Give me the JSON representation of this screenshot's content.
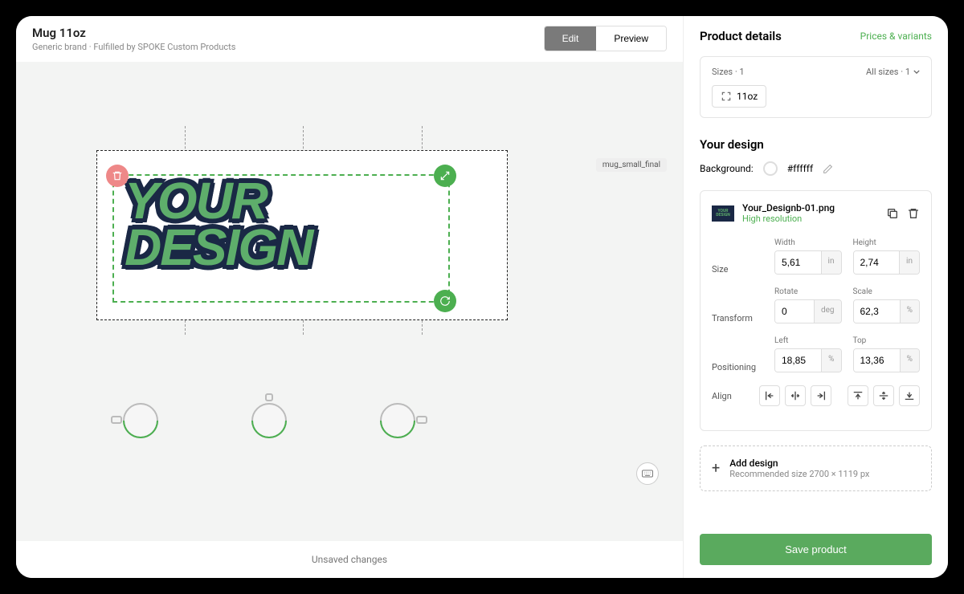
{
  "header": {
    "title": "Mug 11oz",
    "subtitle": "Generic brand · Fulfilled by SPOKE Custom Products",
    "tabs": {
      "edit": "Edit",
      "preview": "Preview"
    }
  },
  "canvas": {
    "design_tag": "mug_small_final",
    "design_text_line1": "YOUR",
    "design_text_line2": "DESIGN"
  },
  "footer": {
    "unsaved": "Unsaved changes"
  },
  "sidebar": {
    "title": "Product details",
    "link": "Prices & variants",
    "sizes": {
      "label": "Sizes · 1",
      "all": "All sizes · 1",
      "chip": "11oz"
    },
    "your_design": "Your design",
    "background": {
      "label": "Background:",
      "value": "#ffffff"
    },
    "design_file": {
      "name": "Your_Designb-01.png",
      "resolution": "High resolution"
    },
    "props": {
      "size_label": "Size",
      "width_label": "Width",
      "width_value": "5,61",
      "width_unit": "in",
      "height_label": "Height",
      "height_value": "2,74",
      "height_unit": "in",
      "transform_label": "Transform",
      "rotate_label": "Rotate",
      "rotate_value": "0",
      "rotate_unit": "deg",
      "scale_label": "Scale",
      "scale_value": "62,3",
      "scale_unit": "%",
      "position_label": "Positioning",
      "left_label": "Left",
      "left_value": "18,85",
      "left_unit": "%",
      "top_label": "Top",
      "top_value": "13,36",
      "top_unit": "%",
      "align_label": "Align"
    },
    "add_design": {
      "title": "Add design",
      "subtitle": "Recommended size 2700 × 1119 px"
    },
    "save": "Save product"
  }
}
